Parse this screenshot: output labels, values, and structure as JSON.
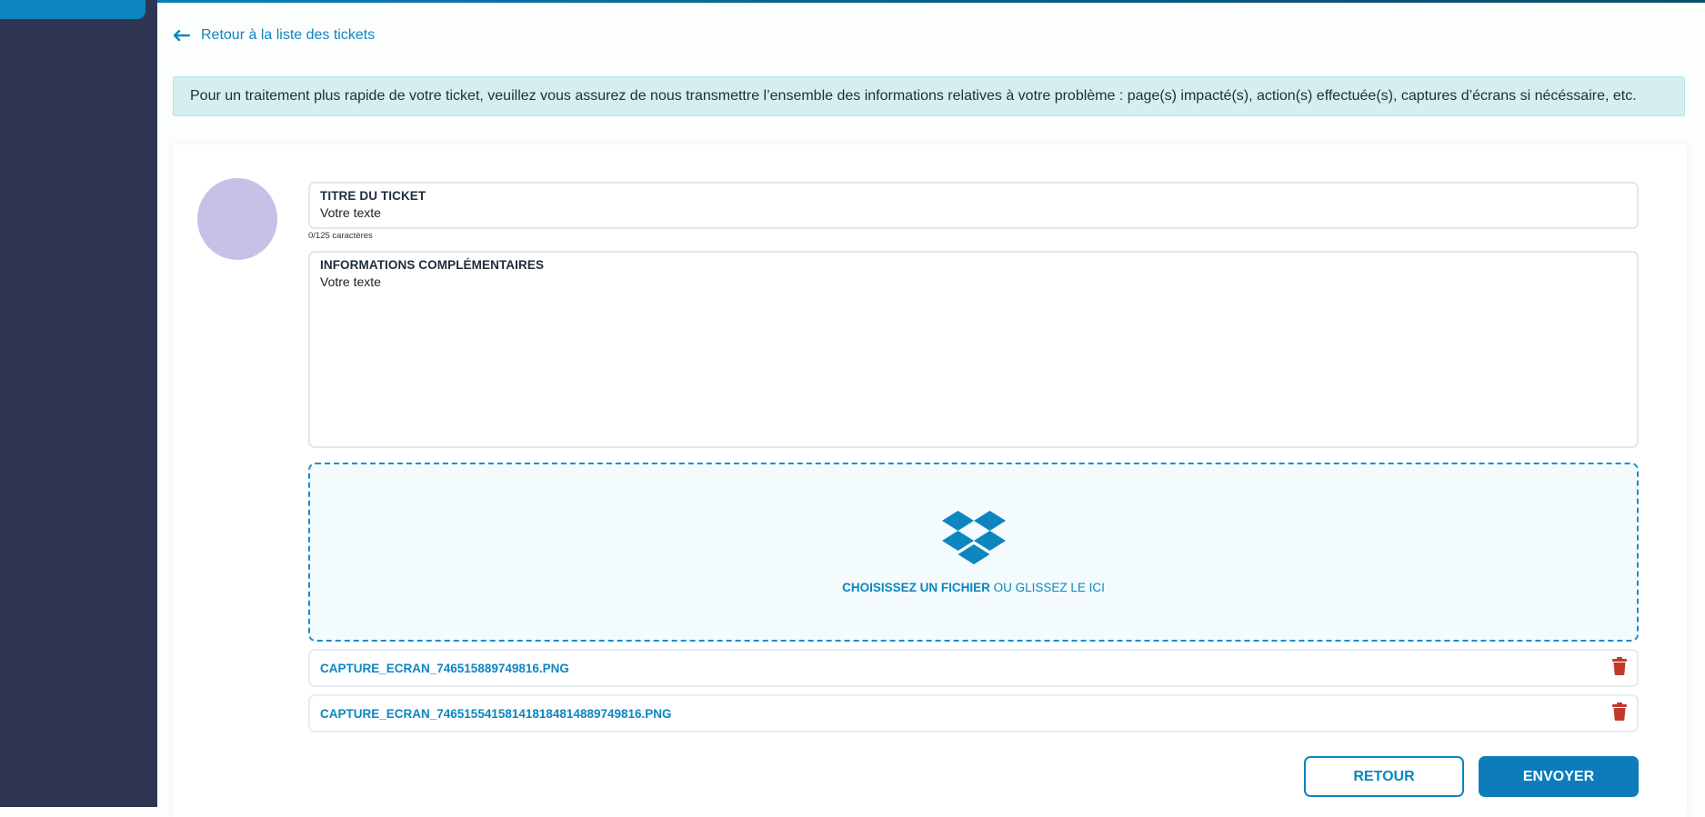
{
  "nav": {
    "back_label": "Retour à la liste des tickets"
  },
  "notice": {
    "text": "Pour un traitement plus rapide de votre ticket, veuillez vous assurez de nous transmettre l’ensemble des informations relatives à votre problème : page(s) impacté(s), action(s) effectuée(s), captures d’écrans si nécéssaire, etc."
  },
  "form": {
    "title": {
      "label": "TITRE DU TICKET",
      "value": "Votre texte",
      "counter": "0/125 caractères"
    },
    "info": {
      "label": "INFORMATIONS COMPLÉMENTAIRES",
      "value": "Votre texte"
    },
    "dropzone": {
      "icon": "dropbox-icon",
      "choose_label": "CHOISISSEZ UN FICHIER",
      "or_label": "OU GLISSEZ LE ICI"
    },
    "files": [
      {
        "name": "CAPTURE_ECRAN_746515889749816.PNG",
        "icon": "trash-icon"
      },
      {
        "name": "CAPTURE_ECRAN_746515541581418184814889749816.PNG",
        "icon": "trash-icon"
      }
    ]
  },
  "actions": {
    "back_button": "RETOUR",
    "send_button": "ENVOYER"
  },
  "colors": {
    "sidebar": "#2e3654",
    "accent": "#0d86c0",
    "notice_bg": "#d5eff1",
    "avatar": "#c8c0e6",
    "danger": "#c0392b"
  }
}
